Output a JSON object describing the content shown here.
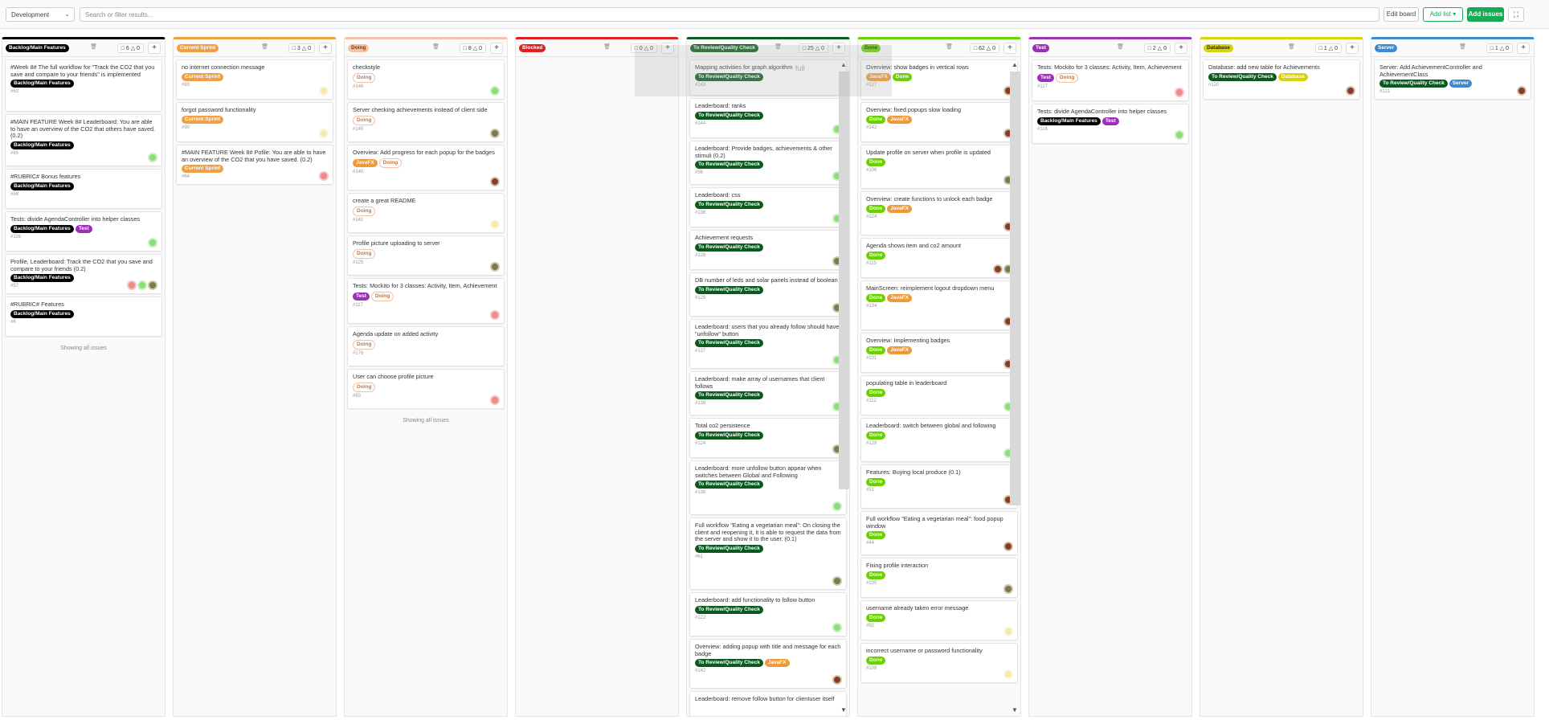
{
  "topbar": {
    "milestone_select": "Development",
    "search_placeholder": "Search or filter results...",
    "edit_board": "Edit board",
    "add_list": "Add list",
    "add_issues": "Add issues"
  },
  "colors": {
    "backlog": "#000000",
    "current_sprint": "#f0a040",
    "doing": "#f3c3a8",
    "blocked": "#e02020",
    "review": "#0a5a1e",
    "done": "#69d100",
    "test": "#9b2fb8",
    "database": "#d7d20a",
    "server": "#3d8ad1",
    "javafx": "#ee9a3a"
  },
  "toast_text": "full",
  "lists": [
    {
      "title": "Backlog/Main Features",
      "color": "#000000",
      "issues": "6",
      "weight": "0",
      "footer": "Showing all issues",
      "cards": [
        {
          "title": "#Week 8# The full workflow for \"Track the CO2 that you save and compare to your friends\" is implemented",
          "labels": [
            {
              "t": "Backlog/Main Features",
              "c": "#000000"
            }
          ],
          "num": "#63",
          "av": []
        },
        {
          "title": "#MAIN FEATURE Week 8# Leaderboard: You are able to have an overview of the CO2 that others have saved. (0.2)",
          "labels": [
            {
              "t": "Backlog/Main Features",
              "c": "#000000"
            }
          ],
          "num": "#65",
          "av": [
            "#8fdc7a"
          ]
        },
        {
          "title": "#RUBRIC# Bonus features",
          "labels": [
            {
              "t": "Backlog/Main Features",
              "c": "#000000"
            }
          ],
          "num": "#58",
          "av": []
        },
        {
          "title": "Tests: divide AgendaController into helper classes",
          "labels": [
            {
              "t": "Backlog/Main Features",
              "c": "#000000"
            },
            {
              "t": "Test",
              "c": "#9b2fb8"
            }
          ],
          "num": "#116",
          "av": [
            "#8fdc7a"
          ]
        },
        {
          "title": "Profile, Leaderboard: Track the CO2 that you save and compare to your friends (0.2)",
          "labels": [
            {
              "t": "Backlog/Main Features",
              "c": "#000000"
            }
          ],
          "num": "#57",
          "av": [
            "#ec8a8a",
            "#8fdc7a",
            "#7a7a52"
          ]
        },
        {
          "title": "#RUBRIC# Features",
          "labels": [
            {
              "t": "Backlog/Main Features",
              "c": "#000000"
            }
          ],
          "num": "#6",
          "av": []
        }
      ]
    },
    {
      "title": "Current Sprint",
      "color": "#f0a040",
      "issues": "3",
      "weight": "0",
      "footer": "",
      "cards": [
        {
          "title": "no internet connection message",
          "labels": [
            {
              "t": "Current Sprint",
              "c": "#f0a040"
            }
          ],
          "num": "#93",
          "av": [
            "#f4eab0"
          ]
        },
        {
          "title": "forgot password functionality",
          "labels": [
            {
              "t": "Current Sprint",
              "c": "#f0a040"
            }
          ],
          "num": "#90",
          "av": [
            "#f4eab0"
          ]
        },
        {
          "title": "#MAIN FEATURE Week 8# Pofile: You are able to have an overview of the CO2 that you have saved. (0.2)",
          "labels": [
            {
              "t": "Current Sprint",
              "c": "#f0a040"
            }
          ],
          "num": "#64",
          "av": [
            "#ec8a8a"
          ]
        }
      ]
    },
    {
      "title": "Doing",
      "color": "#f3c3a8",
      "issues": "8",
      "weight": "0",
      "footer": "Showing all issues",
      "cards": [
        {
          "title": "checkstyle",
          "labels": [
            {
              "t": "Doing",
              "c": "#f3c3a8"
            }
          ],
          "num": "#146",
          "av": [
            "#8fdc7a"
          ]
        },
        {
          "title": "Server checking achievements instead of client side",
          "labels": [
            {
              "t": "Doing",
              "c": "#f3c3a8"
            }
          ],
          "num": "#145",
          "av": [
            "#7a7a52"
          ]
        },
        {
          "title": "Overview: Add progress for each popup for the badges",
          "labels": [
            {
              "t": "JavaFX",
              "c": "#ee9a3a"
            },
            {
              "t": "Doing",
              "c": "#f3c3a8"
            }
          ],
          "num": "#140",
          "av": [
            "#8a3a2a"
          ]
        },
        {
          "title": "create a great README",
          "labels": [
            {
              "t": "Doing",
              "c": "#f3c3a8"
            }
          ],
          "num": "#141",
          "av": [
            "#f4eab0"
          ]
        },
        {
          "title": "Profile picture uploading to server",
          "labels": [
            {
              "t": "Doing",
              "c": "#f3c3a8"
            }
          ],
          "num": "#125",
          "av": [
            "#7a7a52"
          ]
        },
        {
          "title": "Tests: Mockito for 3 classes: Activity, Item, Achievement",
          "labels": [
            {
              "t": "Test",
              "c": "#9b2fb8"
            },
            {
              "t": "Doing",
              "c": "#f3c3a8"
            }
          ],
          "num": "#117",
          "av": [
            "#ec8a8a"
          ]
        },
        {
          "title": "Agenda update on added activity",
          "labels": [
            {
              "t": "Doing",
              "c": "#f3c3a8"
            }
          ],
          "num": "#176",
          "av": []
        },
        {
          "title": "User can choose profile picture",
          "labels": [
            {
              "t": "Doing",
              "c": "#f3c3a8"
            }
          ],
          "num": "#83",
          "av": [
            "#ec8a8a"
          ]
        }
      ]
    },
    {
      "title": "Blocked",
      "color": "#e02020",
      "issues": "0",
      "weight": "0",
      "footer": "",
      "cards": []
    },
    {
      "title": "To Review/Quality Check",
      "color": "#0a5a1e",
      "issues": "25",
      "weight": "0",
      "footer": "",
      "cards": [
        {
          "title": "Mapping activities for graph algorithm",
          "labels": [
            {
              "t": "To Review/Quality Check",
              "c": "#0a5a1e"
            }
          ],
          "num": "#143",
          "av": []
        },
        {
          "title": "Leaderboard: ranks",
          "labels": [
            {
              "t": "To Review/Quality Check",
              "c": "#0a5a1e"
            }
          ],
          "num": "#144",
          "av": [
            "#8fdc7a"
          ]
        },
        {
          "title": "Leaderboard: Provide badges, achievements & other stimuli (0.2)",
          "labels": [
            {
              "t": "To Review/Quality Check",
              "c": "#0a5a1e"
            }
          ],
          "num": "#56",
          "av": [
            "#8fdc7a"
          ]
        },
        {
          "title": "Leaderboard: css",
          "labels": [
            {
              "t": "To Review/Quality Check",
              "c": "#0a5a1e"
            }
          ],
          "num": "#136",
          "av": [
            "#8fdc7a"
          ]
        },
        {
          "title": "Achievement requests",
          "labels": [
            {
              "t": "To Review/Quality Check",
              "c": "#0a5a1e"
            }
          ],
          "num": "#128",
          "av": [
            "#7a7a52"
          ]
        },
        {
          "title": "DB number of leds and solar panels instead of boolean",
          "labels": [
            {
              "t": "To Review/Quality Check",
              "c": "#0a5a1e"
            }
          ],
          "num": "#126",
          "av": [
            "#7a7a52"
          ]
        },
        {
          "title": "Leaderboard: users that you already follow should have \"unfollow\" button",
          "labels": [
            {
              "t": "To Review/Quality Check",
              "c": "#0a5a1e"
            }
          ],
          "num": "#137",
          "av": [
            "#8fdc7a"
          ]
        },
        {
          "title": "Leaderboard: make array of usernames that client follows",
          "labels": [
            {
              "t": "To Review/Quality Check",
              "c": "#0a5a1e"
            }
          ],
          "num": "#139",
          "av": [
            "#8fdc7a"
          ]
        },
        {
          "title": "Total co2 persistence",
          "labels": [
            {
              "t": "To Review/Quality Check",
              "c": "#0a5a1e"
            }
          ],
          "num": "#124",
          "av": [
            "#7a7a52"
          ]
        },
        {
          "title": "Leaderboard: more unfollow button appear when switches between Global and Following",
          "labels": [
            {
              "t": "To Review/Quality Check",
              "c": "#0a5a1e"
            }
          ],
          "num": "#138",
          "av": [
            "#8fdc7a"
          ]
        },
        {
          "title": "Full workflow \"Eating a vegetarian meal\": On closing the client and reopening it, it is able to request the data from the server and show it to the user. (0.1)",
          "labels": [
            {
              "t": "To Review/Quality Check",
              "c": "#0a5a1e"
            }
          ],
          "num": "#61",
          "av": [
            "#7a7a52"
          ]
        },
        {
          "title": "Leaderboard: add functionality to follow button",
          "labels": [
            {
              "t": "To Review/Quality Check",
              "c": "#0a5a1e"
            }
          ],
          "num": "#122",
          "av": [
            "#8fdc7a"
          ]
        },
        {
          "title": "Overview: adding popup with title and message for each badge",
          "labels": [
            {
              "t": "To Review/Quality Check",
              "c": "#0a5a1e"
            },
            {
              "t": "JavaFX",
              "c": "#ee9a3a"
            }
          ],
          "num": "#142",
          "av": [
            "#8a3a2a"
          ]
        },
        {
          "title": "Leaderboard: remove follow button for clientuser itself",
          "labels": [],
          "num": "",
          "av": []
        }
      ]
    },
    {
      "title": "Done",
      "color": "#69d100",
      "issues": "62",
      "weight": "0",
      "footer": "",
      "cards": [
        {
          "title": "Overview: show badges in vertical rows",
          "labels": [
            {
              "t": "JavaFX",
              "c": "#ee9a3a"
            },
            {
              "t": "Done",
              "c": "#69d100"
            }
          ],
          "num": "#127",
          "av": [
            "#8a3a2a"
          ]
        },
        {
          "title": "Overview: fixed popups slow loading",
          "labels": [
            {
              "t": "Done",
              "c": "#69d100"
            },
            {
              "t": "JavaFX",
              "c": "#ee9a3a"
            }
          ],
          "num": "#142",
          "av": [
            "#8a3a2a"
          ]
        },
        {
          "title": "Update profile on server when profile is updated",
          "labels": [
            {
              "t": "Done",
              "c": "#69d100"
            }
          ],
          "num": "#106",
          "av": [
            "#7a7a52"
          ]
        },
        {
          "title": "Overview: create functions to unlock each badge",
          "labels": [
            {
              "t": "Done",
              "c": "#69d100"
            },
            {
              "t": "JavaFX",
              "c": "#ee9a3a"
            }
          ],
          "num": "#124",
          "av": [
            "#8a3a2a"
          ]
        },
        {
          "title": "Agenda shows item and co2 amount",
          "labels": [
            {
              "t": "Done",
              "c": "#69d100"
            }
          ],
          "num": "#115",
          "av": [
            "#8a3a2a",
            "#7a7a52"
          ]
        },
        {
          "title": "MainScreen: reimplement logout dropdown menu",
          "labels": [
            {
              "t": "Done",
              "c": "#69d100"
            },
            {
              "t": "JavaFX",
              "c": "#ee9a3a"
            }
          ],
          "num": "#134",
          "av": [
            "#8a3a2a"
          ]
        },
        {
          "title": "Overview: Implementing badges",
          "labels": [
            {
              "t": "Done",
              "c": "#69d100"
            },
            {
              "t": "JavaFX",
              "c": "#ee9a3a"
            }
          ],
          "num": "#101",
          "av": [
            "#8a3a2a"
          ]
        },
        {
          "title": "populating table in leaderboard",
          "labels": [
            {
              "t": "Done",
              "c": "#69d100"
            }
          ],
          "num": "#112",
          "av": [
            "#8fdc7a"
          ]
        },
        {
          "title": "Leaderboard: switch between global and following",
          "labels": [
            {
              "t": "Done",
              "c": "#69d100"
            }
          ],
          "num": "#129",
          "av": [
            "#8fdc7a"
          ]
        },
        {
          "title": "Features: Buying local produce (0.1)",
          "labels": [
            {
              "t": "Done",
              "c": "#69d100"
            }
          ],
          "num": "#51",
          "av": [
            "#8a3a2a"
          ]
        },
        {
          "title": "Full workflow \"Eating a vegetarian meal\": food popup window",
          "labels": [
            {
              "t": "Done",
              "c": "#69d100"
            }
          ],
          "num": "#44",
          "av": [
            "#8a3a2a"
          ]
        },
        {
          "title": "Fixing profile interaction",
          "labels": [
            {
              "t": "Done",
              "c": "#69d100"
            }
          ],
          "num": "#105",
          "av": [
            "#7a7a52"
          ]
        },
        {
          "title": "username already taken error message",
          "labels": [
            {
              "t": "Done",
              "c": "#69d100"
            }
          ],
          "num": "#92",
          "av": [
            "#f4eab0"
          ]
        },
        {
          "title": "incorrect username or password functionality",
          "labels": [
            {
              "t": "Done",
              "c": "#69d100"
            }
          ],
          "num": "#109",
          "av": [
            "#f4eab0"
          ]
        }
      ]
    },
    {
      "title": "Test",
      "color": "#9b2fb8",
      "issues": "2",
      "weight": "0",
      "footer": "",
      "cards": [
        {
          "title": "Tests: Mockito for 3 classes: Activity, Item, Achievement",
          "labels": [
            {
              "t": "Test",
              "c": "#9b2fb8"
            },
            {
              "t": "Doing",
              "c": "#f3c3a8"
            }
          ],
          "num": "#117",
          "av": [
            "#ec8a8a"
          ]
        },
        {
          "title": "Tests: divide AgendaController into helper classes",
          "labels": [
            {
              "t": "Backlog/Main Features",
              "c": "#000000"
            },
            {
              "t": "Test",
              "c": "#9b2fb8"
            }
          ],
          "num": "#116",
          "av": [
            "#8fdc7a"
          ]
        }
      ]
    },
    {
      "title": "Database",
      "color": "#d7d20a",
      "issues": "1",
      "weight": "0",
      "footer": "",
      "cards": [
        {
          "title": "Database: add new table for Achievements",
          "labels": [
            {
              "t": "To Review/Quality Check",
              "c": "#0a5a1e"
            },
            {
              "t": "Database",
              "c": "#d7d20a"
            }
          ],
          "num": "#120",
          "av": [
            "#8a3a2a"
          ]
        }
      ]
    },
    {
      "title": "Server",
      "color": "#3d8ad1",
      "issues": "1",
      "weight": "0",
      "footer": "",
      "cards": [
        {
          "title": "Server: Add AchievementController and AchievementClass",
          "labels": [
            {
              "t": "To Review/Quality Check",
              "c": "#0a5a1e"
            },
            {
              "t": "Server",
              "c": "#3d8ad1"
            }
          ],
          "num": "#121",
          "av": [
            "#8a3a2a"
          ]
        }
      ]
    }
  ]
}
